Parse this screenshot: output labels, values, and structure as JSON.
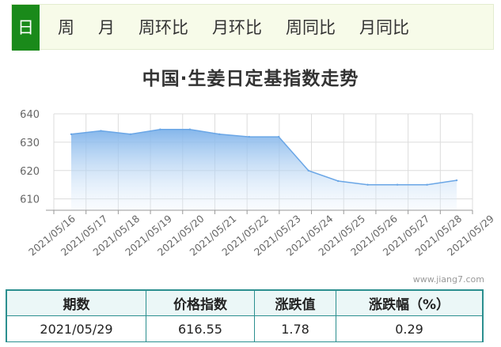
{
  "tabs": [
    {
      "label": "日",
      "active": true
    },
    {
      "label": "周",
      "active": false
    },
    {
      "label": "月",
      "active": false
    },
    {
      "label": "周环比",
      "active": false
    },
    {
      "label": "月环比",
      "active": false
    },
    {
      "label": "周同比",
      "active": false
    },
    {
      "label": "月同比",
      "active": false
    }
  ],
  "watermark": "www.jiang7.com",
  "colors": {
    "accent_tab": "#1a8a1a",
    "area_top": "#7fb3ea",
    "line": "#6aa6e6",
    "table_border": "#2b8f8f",
    "table_head_bg": "#ebf7f7"
  },
  "chart_data": {
    "type": "area",
    "title": "中国·生姜日定基指数走势",
    "xlabel": "",
    "ylabel": "",
    "ylim": [
      606,
      640
    ],
    "yticks": [
      610,
      620,
      630,
      640
    ],
    "grid": true,
    "x": [
      "2021/05/16",
      "2021/05/17",
      "2021/05/18",
      "2021/05/19",
      "2021/05/20",
      "2021/05/21",
      "2021/05/22",
      "2021/05/23",
      "2021/05/24",
      "2021/05/25",
      "2021/05/26",
      "2021/05/27",
      "2021/05/28",
      "2021/05/29"
    ],
    "values": [
      632.8,
      634.0,
      632.8,
      634.5,
      634.5,
      632.8,
      631.9,
      631.9,
      620.0,
      616.3,
      615.0,
      615.0,
      615.0,
      616.55
    ]
  },
  "table": {
    "headers": [
      "期数",
      "价格指数",
      "涨跌值",
      "涨跌幅（%）"
    ],
    "row": [
      "2021/05/29",
      "616.55",
      "1.78",
      "0.29"
    ]
  }
}
